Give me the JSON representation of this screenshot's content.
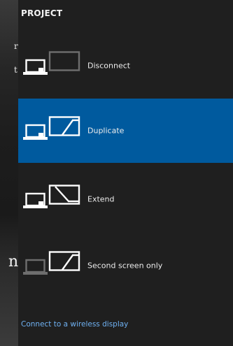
{
  "panel": {
    "title": "PROJECT",
    "options": [
      {
        "label": "Disconnect",
        "icon": "disconnect-icon",
        "selected": false
      },
      {
        "label": "Duplicate",
        "icon": "duplicate-icon",
        "selected": true
      },
      {
        "label": "Extend",
        "icon": "extend-icon",
        "selected": false
      },
      {
        "label": "Second screen only",
        "icon": "second-screen-icon",
        "selected": false
      }
    ],
    "wireless_link": "Connect to a wireless display"
  },
  "background": {
    "fragments": [
      "r",
      "t",
      "n"
    ]
  },
  "colors": {
    "panel_bg": "#1f1f1f",
    "selected_bg": "#005a9e",
    "link": "#6fb1f2",
    "text": "#ededed",
    "icon_active": "#ffffff",
    "icon_dim": "#6e6e6e"
  }
}
